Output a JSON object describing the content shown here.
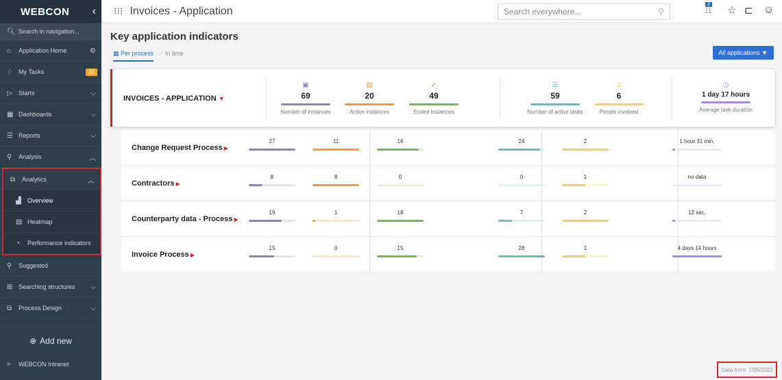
{
  "brand": "WEBCON",
  "sidebar": {
    "search_placeholder": "Search in navigation...",
    "items": [
      {
        "label": "Application Home",
        "icon": "home-icon",
        "right": "⚙"
      },
      {
        "label": "My Tasks",
        "icon": "bell-icon",
        "badge": "33"
      },
      {
        "label": "Starts",
        "icon": "play-icon",
        "right": "⌵"
      },
      {
        "label": "Dashboards",
        "icon": "dashboard-icon",
        "right": "⌵"
      },
      {
        "label": "Reports",
        "icon": "table-icon",
        "right": "⌵"
      },
      {
        "label": "Analysis",
        "icon": "people-icon",
        "right": "︿"
      }
    ],
    "analytics": {
      "label": "Analytics",
      "right": "︿",
      "children": [
        "Overview",
        "Heatmap",
        "Performance indicators"
      ]
    },
    "after": [
      {
        "label": "Suggested",
        "icon": "people-icon"
      },
      {
        "label": "Searching structures",
        "icon": "tree-icon",
        "right": "⌵"
      },
      {
        "label": "Process Design",
        "icon": "design-icon",
        "right": "⌵"
      }
    ],
    "add_new": "Add new",
    "intranet": "WEBCON Intranet"
  },
  "topbar": {
    "title": "Invoices - Application",
    "search_placeholder": "Search everywhere...",
    "notifications": "2"
  },
  "main": {
    "title": "Key application indicators",
    "tabs": [
      "Per process",
      "In time"
    ],
    "all_apps_button": "All applications ▼",
    "summary": {
      "name": "INVOICES - APPLICATION",
      "metrics": [
        {
          "value": "69",
          "label": "Number of instances",
          "color": "#8b86b8"
        },
        {
          "value": "20",
          "label": "Active instances",
          "color": "#f29b2e"
        },
        {
          "value": "49",
          "label": "Ended instances",
          "color": "#7ab55c"
        },
        {
          "value": "59",
          "label": "Number of active tasks",
          "color": "#6fb7bd"
        },
        {
          "value": "6",
          "label": "People involved",
          "color": "#f2cf6a"
        },
        {
          "value": "1 day 17 hours",
          "label": "Average task duration",
          "color": "#a78ad8"
        }
      ]
    },
    "processes": [
      {
        "name": "Change Request Process",
        "values": [
          "27",
          "11",
          "16",
          "24",
          "2",
          "1 hour 31 min."
        ],
        "fills": [
          1.0,
          1.0,
          0.9,
          0.9,
          1.0,
          0.04
        ]
      },
      {
        "name": "Contractors",
        "values": [
          "8",
          "8",
          "0",
          "0",
          "1",
          "no data"
        ],
        "fills": [
          0.3,
          1.0,
          0.0,
          0.0,
          0.5,
          0.0
        ]
      },
      {
        "name": "Counterparty data - Process",
        "values": [
          "19",
          "1",
          "18",
          "7",
          "2",
          "12 sec."
        ],
        "fills": [
          0.7,
          0.05,
          1.0,
          0.3,
          1.0,
          0.03
        ]
      },
      {
        "name": "Invoice Process",
        "values": [
          "15",
          "0",
          "15",
          "28",
          "1",
          "4 days 14 hours"
        ],
        "fills": [
          0.55,
          0.0,
          0.85,
          1.0,
          0.5,
          1.0
        ]
      }
    ],
    "data_from": "Data from: 7/26/2023"
  }
}
